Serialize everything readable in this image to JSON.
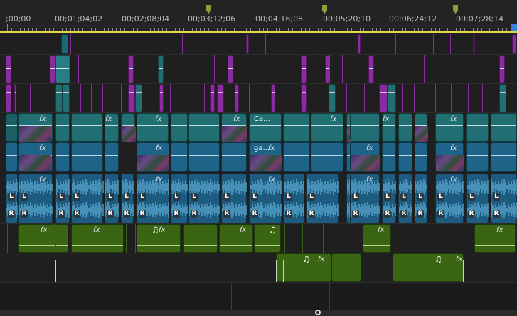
{
  "timecodes": [
    ";00;00",
    "00;01;04;02",
    "00;02;08;04",
    "00;03;12;06",
    "00;04;16;08",
    "00;05;20;10",
    "00;06;24;12",
    "00;07;28;14"
  ],
  "clip_labels": {
    "ca": "Ca...",
    "ga": "ga..."
  },
  "fx_label": "fx",
  "note_label": "♫",
  "audio_channels": {
    "left": "L",
    "right": "R"
  },
  "colors": {
    "background": "#1e1e1e",
    "video_teal": "#216f73",
    "video_teal_dark": "#1a5f63",
    "video_blue": "#1d6488",
    "video_purple": "#8a2ba0",
    "audio_blue": "#1d5c80",
    "waveform": "#6fc4ef",
    "audio_green": "#3a6614",
    "audio_green_light": "#b5d68a",
    "playline": "#e3d84a",
    "marker": "#8aa040",
    "playhead": "#3b7fe0"
  },
  "icons": [
    "marker-icon",
    "playhead-icon",
    "scroll-knob-icon",
    "music-note-icon"
  ]
}
